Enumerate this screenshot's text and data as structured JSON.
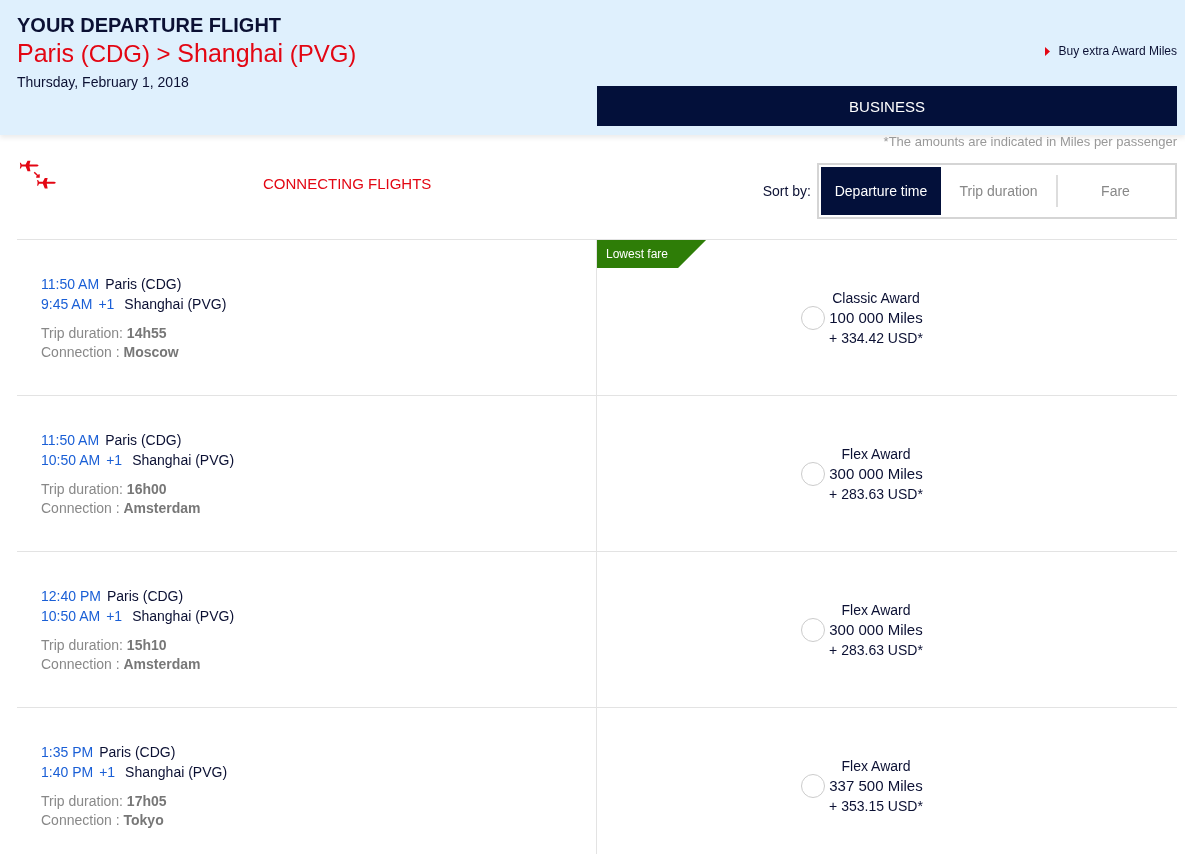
{
  "header": {
    "title": "YOUR DEPARTURE FLIGHT",
    "route": "**Paris** (CDG) > **Shanghai** (PVG)",
    "date": "Thursday, February 1, 2018",
    "buy_link": "Buy extra Award Miles",
    "cabin": "BUSINESS",
    "note": "*The amounts are indicated in Miles per passenger"
  },
  "section_title": "CONNECTING FLIGHTS",
  "sort": {
    "label": "Sort by:",
    "options": [
      {
        "label": "Departure time",
        "selected": true
      },
      {
        "label": "Trip duration",
        "selected": false
      },
      {
        "label": "Fare",
        "selected": false
      }
    ]
  },
  "flights": [
    {
      "dep_time": "11:50 AM",
      "dep_airport": "Paris (CDG)",
      "arr_time": "9:45 AM",
      "day_offset": "+1",
      "arr_airport": "Shanghai (PVG)",
      "duration": "Trip duration: **14h55**",
      "connection": "Connection : **Moscow**",
      "badge": "Lowest fare",
      "fare": "Classic Award",
      "miles": "100 000 Miles",
      "surcharge": "+ 334.42 USD*",
      "selected": false
    },
    {
      "dep_time": "11:50 AM",
      "dep_airport": "Paris (CDG)",
      "arr_time": "10:50 AM",
      "day_offset": "+1",
      "arr_airport": "Shanghai (PVG)",
      "duration": "Trip duration: **16h00**",
      "connection": "Connection : **Amsterdam**",
      "fare": "Flex Award",
      "miles": "300 000 Miles",
      "surcharge": "+ 283.63 USD*",
      "selected": false
    },
    {
      "dep_time": "12:40 PM",
      "dep_airport": "Paris (CDG)",
      "arr_time": "10:50 AM",
      "day_offset": "+1",
      "arr_airport": "Shanghai (PVG)",
      "duration": "Trip duration: **15h10**",
      "connection": "Connection : **Amsterdam**",
      "fare": "Flex Award",
      "miles": "300 000 Miles",
      "surcharge": "+ 283.63 USD*",
      "selected": false
    },
    {
      "dep_time": "1:35 PM",
      "dep_airport": "Paris (CDG)",
      "arr_time": "1:40 PM",
      "day_offset": "+1",
      "arr_airport": "Shanghai (PVG)",
      "duration": "Trip duration: **17h05**",
      "connection": "Connection : **Tokyo**",
      "fare": "Flex Award",
      "miles": "337 500 Miles",
      "surcharge": "+ 353.15 USD*",
      "selected": false
    }
  ]
}
